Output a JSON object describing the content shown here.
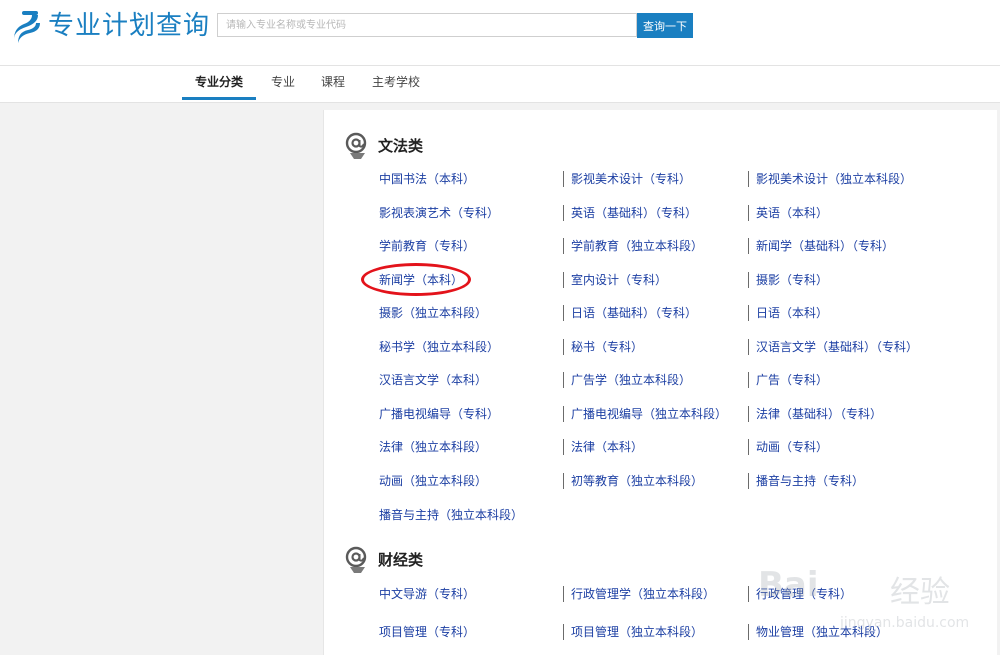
{
  "header": {
    "title": "专业计划查询",
    "search_placeholder": "请输入专业名称或专业代码",
    "search_button": "查询一下",
    "logo_icon": "brand-logo-icon",
    "brand_color": "#1a7fc1"
  },
  "nav": {
    "tabs": [
      {
        "label": "专业分类",
        "active": true
      },
      {
        "label": "专业",
        "active": false
      },
      {
        "label": "课程",
        "active": false
      },
      {
        "label": "主考学校",
        "active": false
      }
    ]
  },
  "sections": [
    {
      "title": "文法类",
      "icon": "at-sign-icon",
      "rows": [
        [
          "中国书法（本科）",
          "影视美术设计（专科）",
          "影视美术设计（独立本科段）"
        ],
        [
          "影视表演艺术（专科）",
          "英语（基础科）（专科）",
          "英语（本科）"
        ],
        [
          "学前教育（专科）",
          "学前教育（独立本科段）",
          "新闻学（基础科）（专科）"
        ],
        [
          "新闻学（本科）",
          "室内设计（专科）",
          "摄影（专科）"
        ],
        [
          "摄影（独立本科段）",
          "日语（基础科）（专科）",
          "日语（本科）"
        ],
        [
          "秘书学（独立本科段）",
          "秘书（专科）",
          "汉语言文学（基础科）（专科）"
        ],
        [
          "汉语言文学（本科）",
          "广告学（独立本科段）",
          "广告（专科）"
        ],
        [
          "广播电视编导（专科）",
          "广播电视编导（独立本科段）",
          "法律（基础科）（专科）"
        ],
        [
          "法律（独立本科段）",
          "法律（本科）",
          "动画（专科）"
        ],
        [
          "动画（独立本科段）",
          "初等教育（独立本科段）",
          "播音与主持（专科）"
        ],
        [
          "播音与主持（独立本科段）"
        ]
      ]
    },
    {
      "title": "财经类",
      "icon": "at-sign-icon",
      "rows": [
        [
          "中文导游（专科）",
          "行政管理学（独立本科段）",
          "行政管理（专科）"
        ],
        [
          "项目管理（专科）",
          "项目管理（独立本科段）",
          "物业管理（独立本科段）"
        ]
      ]
    }
  ],
  "highlight": {
    "label": "新闻学（本科）",
    "color": "#e3131b"
  },
  "watermark": {
    "brand": "Bai",
    "brand2": "经验",
    "url": "jingyan.baidu.com"
  },
  "colors": {
    "link": "#1c3fa3",
    "background": "#f2f2f2"
  }
}
